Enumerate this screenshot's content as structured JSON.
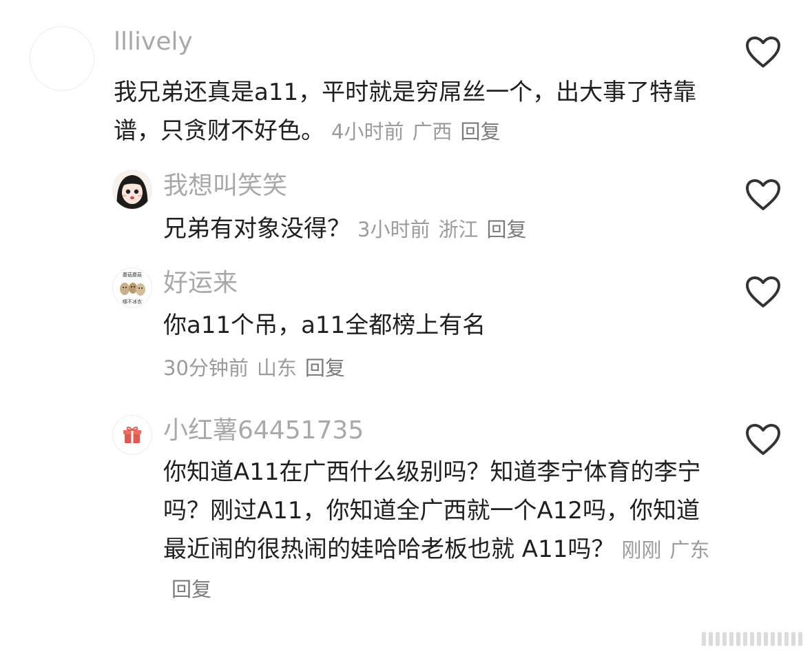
{
  "comments": [
    {
      "username": "lllively",
      "text": "我兄弟还真是a11，平时就是穷屌丝一个，出大事了特靠谱，只贪财不好色。",
      "time": "4小时前",
      "location": "广西",
      "reply": "回复"
    },
    {
      "username": "我想叫笑笑",
      "text": "兄弟有对象没得？",
      "time": "3小时前",
      "location": "浙江",
      "reply": "回复"
    },
    {
      "username": "好运来",
      "text": "你a11个吊，a11全都榜上有名",
      "time": "30分钟前",
      "location": "山东",
      "reply": "回复",
      "avatar_text": {
        "top": "蘑菇蘑菇",
        "bottom": "哪不冰衣"
      }
    },
    {
      "username": "小红薯64451735",
      "text": "你知道A11在广西什么级别吗？知道李宁体育的李宁吗？刚过A11，你知道全广西就一个A12吗，你知道最近闹的很热闹的娃哈哈老板也就 A11吗？",
      "time": "刚刚",
      "location": "广东",
      "reply": "回复"
    }
  ],
  "icons": {
    "like": "heart-outline-icon",
    "gift": "gift-icon"
  },
  "colors": {
    "username": "#a8a8a8",
    "body": "#1f1f1f",
    "meta": "#9b9b9b",
    "heart": "#333333",
    "gift": "#e0584f"
  }
}
